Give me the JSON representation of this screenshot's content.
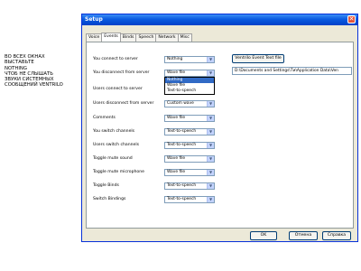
{
  "note": {
    "lines": [
      "Во всех окнах",
      "выставьте",
      "Nothing",
      "чтоб не слышать",
      "звуки системных",
      "сообщений Ventrilo"
    ]
  },
  "window": {
    "title": "Setup",
    "close_glyph": "✕"
  },
  "tabs": [
    {
      "label": "Voice"
    },
    {
      "label": "Events"
    },
    {
      "label": "Binds"
    },
    {
      "label": "Speech"
    },
    {
      "label": "Network"
    },
    {
      "label": "Misc"
    }
  ],
  "events": [
    {
      "label": "You connect to server",
      "value": "Nothing"
    },
    {
      "label": "You disconnect from server",
      "value": "Wave file"
    },
    {
      "label": "Users connect to server",
      "value": "Nothing"
    },
    {
      "label": "Users disconnect from server",
      "value": "Custom wave"
    },
    {
      "label": "Comments",
      "value": "Wave file"
    },
    {
      "label": "You switch channels",
      "value": "Text-to-speech"
    },
    {
      "label": "Users switch channels",
      "value": "Text-to-speech"
    },
    {
      "label": "Toggle mute sound",
      "value": "Wave file"
    },
    {
      "label": "Toggle mute microphone",
      "value": "Wave file"
    },
    {
      "label": "Toggle Binds",
      "value": "Text-to-speech"
    },
    {
      "label": "Switch Bindings",
      "value": "Text-to-speech"
    }
  ],
  "dropdown_options": [
    "Nothing",
    "Wave file",
    "Text-to-speech"
  ],
  "dropdown_selected": "Nothing",
  "event_text_button": "Ventrilo Event Text file",
  "event_text_path": "D:\\Documents and Settings\\Ти\\Application Data\\Ven",
  "buttons": {
    "ok": "OK",
    "cancel": "Отмена",
    "help": "Справка"
  },
  "arrow_glyph": "▼"
}
